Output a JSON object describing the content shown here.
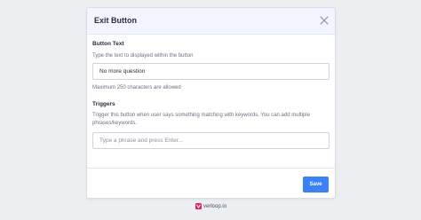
{
  "modal": {
    "title": "Exit Button",
    "button_text": {
      "label": "Button Text",
      "help": "Type the text to displayed within the button",
      "value": "No more question",
      "limit_note": "Maximum 250 characters are allowed"
    },
    "triggers": {
      "label": "Triggers",
      "help": "Trigger this button when user says something matching with keywords. You can add multiple phrases/keywords.",
      "placeholder": "Type a phrase and press Enter..."
    },
    "save_label": "Save"
  },
  "brand": {
    "text": "verloop.io"
  },
  "colors": {
    "accent": "#3b82f6",
    "header_bg": "#f2f5ff",
    "brand_mark": "#e0245e"
  },
  "icons": {
    "close": "close-icon",
    "brand": "verloop-logo"
  }
}
